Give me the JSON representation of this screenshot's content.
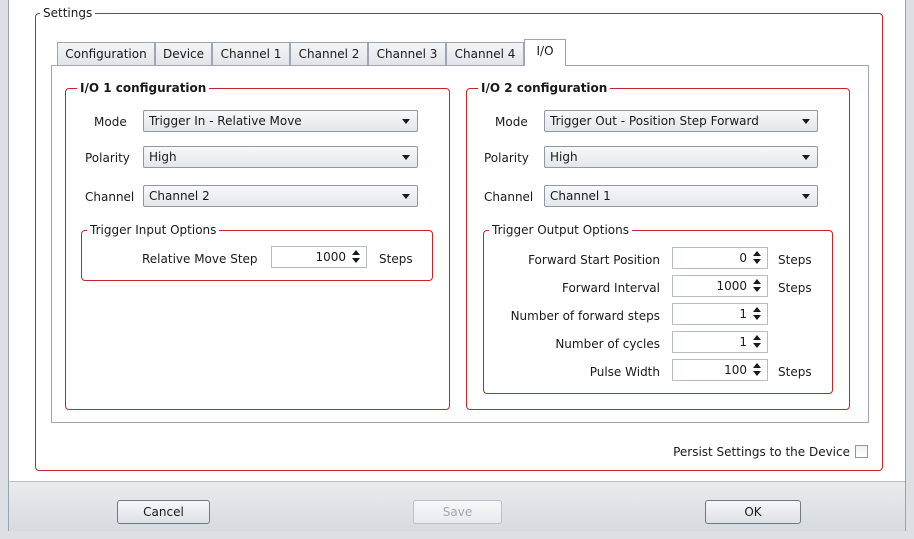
{
  "settings_group": {
    "title": "Settings"
  },
  "tabs": [
    {
      "label": "Configuration"
    },
    {
      "label": "Device"
    },
    {
      "label": "Channel 1"
    },
    {
      "label": "Channel 2"
    },
    {
      "label": "Channel 3"
    },
    {
      "label": "Channel 4"
    },
    {
      "label": "I/O",
      "active": true
    }
  ],
  "io1": {
    "title": "I/O 1 configuration",
    "mode_label": "Mode",
    "mode_value": "Trigger In - Relative Move",
    "polarity_label": "Polarity",
    "polarity_value": "High",
    "channel_label": "Channel",
    "channel_value": "Channel 2",
    "trigger_input": {
      "title": "Trigger Input Options",
      "relative_move_step_label": "Relative Move Step",
      "relative_move_step_value": "1000",
      "relative_move_step_unit": "Steps"
    }
  },
  "io2": {
    "title": "I/O 2 configuration",
    "mode_label": "Mode",
    "mode_value": "Trigger Out - Position Step Forward",
    "polarity_label": "Polarity",
    "polarity_value": "High",
    "channel_label": "Channel",
    "channel_value": "Channel 1",
    "trigger_output": {
      "title": "Trigger Output Options",
      "forward_start_label": "Forward Start Position",
      "forward_start_value": "0",
      "forward_start_unit": "Steps",
      "forward_interval_label": "Forward Interval",
      "forward_interval_value": "1000",
      "forward_interval_unit": "Steps",
      "num_forward_steps_label": "Number of forward steps",
      "num_forward_steps_value": "1",
      "num_cycles_label": "Number of cycles",
      "num_cycles_value": "1",
      "pulse_width_label": "Pulse Width",
      "pulse_width_value": "100",
      "pulse_width_unit": "Steps"
    }
  },
  "persist": {
    "label": "Persist Settings to the Device",
    "checked": false
  },
  "buttons": {
    "cancel": "Cancel",
    "save": "Save",
    "ok": "OK"
  },
  "colors": {
    "group_border": "#c0282d",
    "tab_border": "#9ea7b1",
    "footer_bg": "#e1e4e8"
  }
}
